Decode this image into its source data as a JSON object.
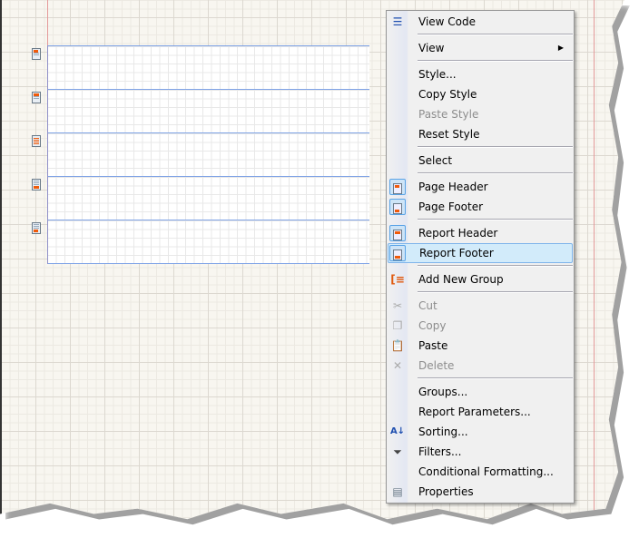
{
  "report_bands": [
    {
      "name": "page-header-band",
      "icon": "page-header-icon"
    },
    {
      "name": "report-header-band",
      "icon": "report-header-icon"
    },
    {
      "name": "detail-band",
      "icon": "detail-icon"
    },
    {
      "name": "report-footer-band",
      "icon": "report-footer-icon"
    },
    {
      "name": "page-footer-band",
      "icon": "page-footer-icon"
    }
  ],
  "menu": {
    "view_code": "View Code",
    "view": "View",
    "style": "Style...",
    "copy_style": "Copy Style",
    "paste_style": "Paste Style",
    "reset_style": "Reset Style",
    "select": "Select",
    "page_header": "Page Header",
    "page_footer": "Page Footer",
    "report_header": "Report Header",
    "report_footer": "Report Footer",
    "add_new_group": "Add New Group",
    "cut": "Cut",
    "copy": "Copy",
    "paste": "Paste",
    "delete": "Delete",
    "groups": "Groups...",
    "report_parameters": "Report Parameters...",
    "sorting": "Sorting...",
    "filters": "Filters...",
    "conditional_formatting": "Conditional Formatting...",
    "properties": "Properties"
  },
  "colors": {
    "highlight": "#d2ebfa",
    "band_border": "#7fa3e6",
    "accent": "#f05a0a"
  }
}
